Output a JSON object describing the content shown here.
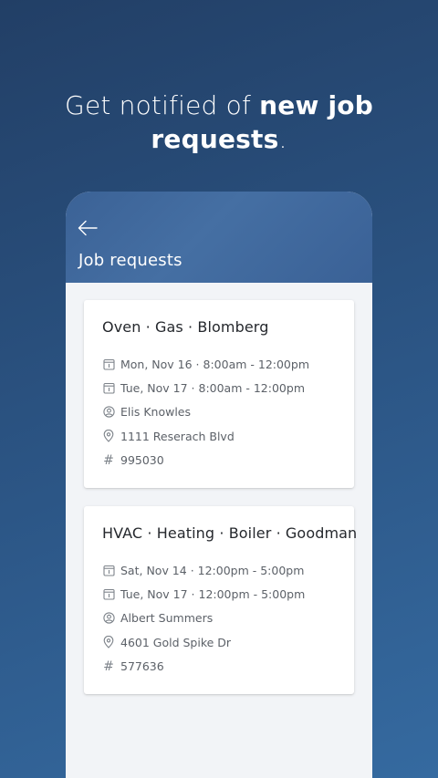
{
  "headline": {
    "prefix": "Get notified of ",
    "bold": "new job requests",
    "suffix": "."
  },
  "appbar": {
    "title": "Job requests"
  },
  "jobs": [
    {
      "title": "Oven · Gas · Blomberg",
      "slot1": "Mon, Nov 16 · 8:00am - 12:00pm",
      "slot2": "Tue, Nov 17 · 8:00am - 12:00pm",
      "customer": "Elis Knowles",
      "address": "1111 Reserach Blvd",
      "number": "995030"
    },
    {
      "title": "HVAC · Heating · Boiler · Goodman",
      "slot1": "Sat, Nov 14 · 12:00pm - 5:00pm",
      "slot2": "Tue, Nov 17 · 12:00pm - 5:00pm",
      "customer": "Albert Summers",
      "address": "4601 Gold Spike Dr",
      "number": "577636"
    }
  ],
  "icons": {
    "back": "arrow-left-icon",
    "calendar": "calendar-icon",
    "person": "person-icon",
    "location": "location-pin-icon",
    "hash": "#"
  },
  "colors": {
    "background": "#2c5686",
    "appbar": "#456fa3",
    "card": "#ffffff"
  }
}
